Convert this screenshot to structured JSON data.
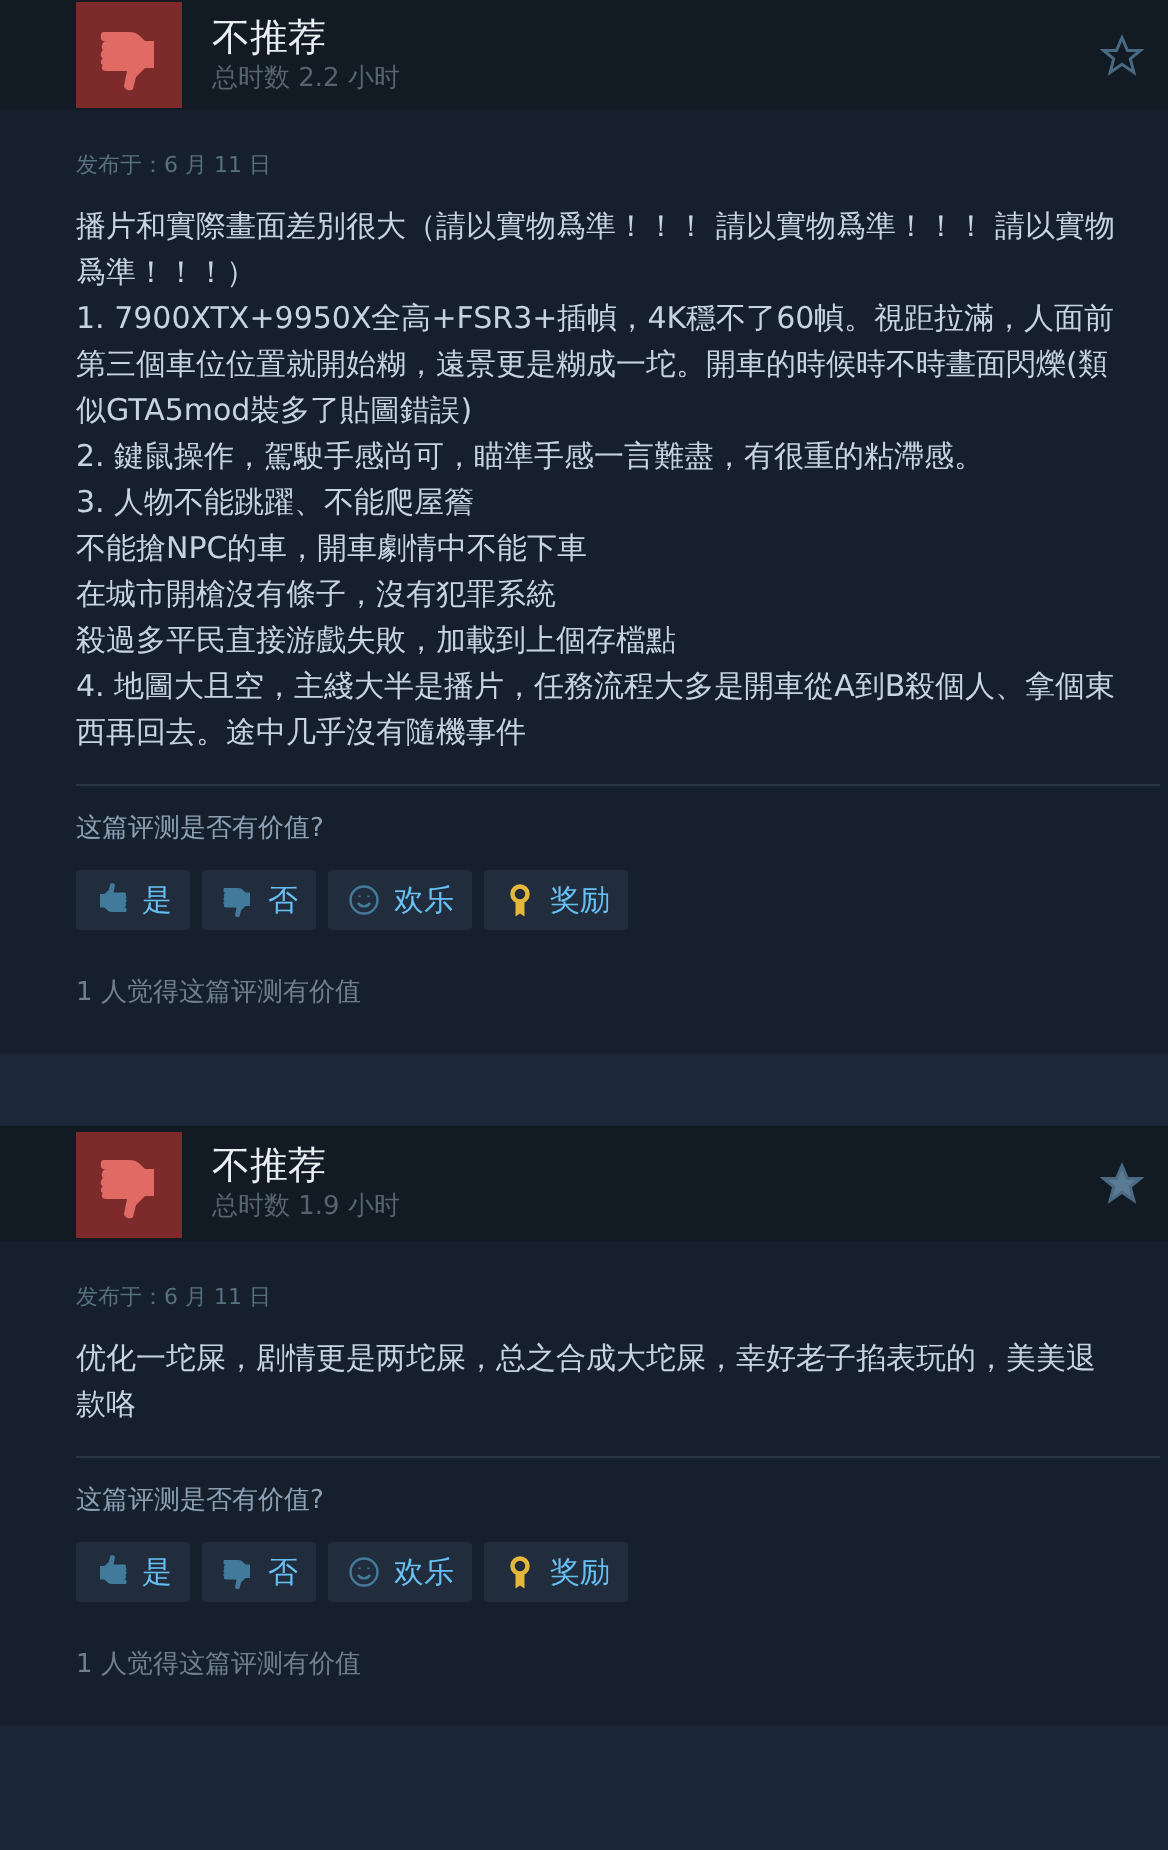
{
  "reviews": [
    {
      "verdict": "不推荐",
      "recommended": false,
      "playtime": "总时数 2.2 小时",
      "starred": false,
      "posted": "发布于：6 月 11 日",
      "body": [
        "播片和實際畫面差別很大（請以實物爲準！！！ 請以實物爲準！！！ 請以實物爲準！！！）",
        "1. 7900XTX+9950X全高+FSR3+插幀，4K穩不了60幀。視距拉滿，人面前第三個車位位置就開始糊，遠景更是糊成一坨。開車的時候時不時畫面閃爍(類似GTA5mod裝多了貼圖錯誤)",
        "2. 鍵鼠操作，駕駛手感尚可，瞄準手感一言難盡，有很重的粘滯感。",
        "3. 人物不能跳躍、不能爬屋簷",
        "不能搶NPC的車，開車劇情中不能下車",
        "在城市開槍沒有條子，沒有犯罪系統",
        "殺過多平民直接游戲失敗，加載到上個存檔點",
        "4. 地圖大且空，主綫大半是播片，任務流程大多是開車從A到B殺個人、拿個東西再回去。途中几乎沒有隨機事件"
      ],
      "question": "这篇评测是否有价值?",
      "buttons": [
        {
          "kind": "yes",
          "label": "是"
        },
        {
          "kind": "no",
          "label": "否"
        },
        {
          "kind": "funny",
          "label": "欢乐"
        },
        {
          "kind": "award",
          "label": "奖励"
        }
      ],
      "helpful": "1 人觉得这篇评测有价值"
    },
    {
      "verdict": "不推荐",
      "recommended": false,
      "playtime": "总时数 1.9 小时",
      "starred": true,
      "posted": "发布于：6 月 11 日",
      "body": [
        "优化一坨屎，剧情更是两坨屎，总之合成大坨屎，幸好老子掐表玩的，美美退款咯"
      ],
      "question": "这篇评测是否有价值?",
      "buttons": [
        {
          "kind": "yes",
          "label": "是"
        },
        {
          "kind": "no",
          "label": "否"
        },
        {
          "kind": "funny",
          "label": "欢乐"
        },
        {
          "kind": "award",
          "label": "奖励"
        }
      ],
      "helpful": "1 人觉得这篇评测有价值"
    }
  ]
}
